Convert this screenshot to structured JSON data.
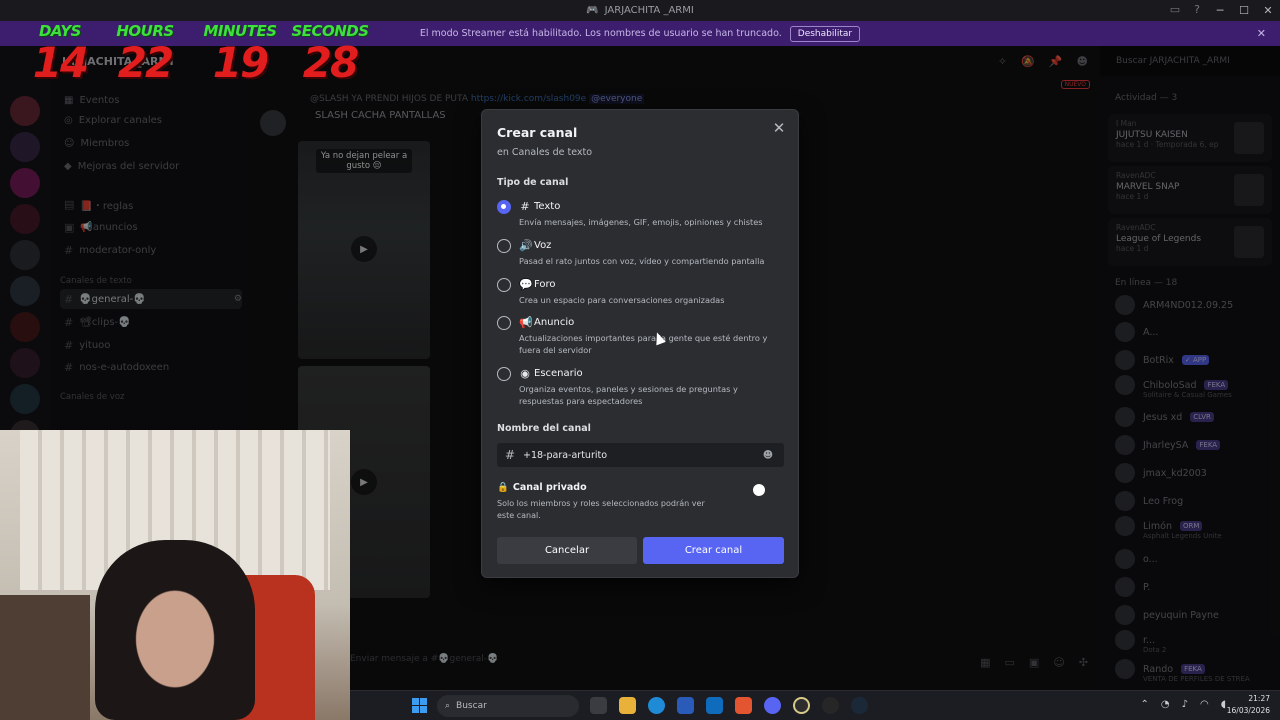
{
  "window": {
    "title": "JARJACHITA _ARMI"
  },
  "banner": {
    "text": "El modo Streamer está habilitado. Los nombres de usuario se han truncado.",
    "button": "Deshabilitar"
  },
  "countdown": [
    {
      "label": "DAYS",
      "value": "14"
    },
    {
      "label": "HOURS",
      "value": "22"
    },
    {
      "label": "MINUTES",
      "value": "19"
    },
    {
      "label": "SECONDS",
      "value": "28"
    }
  ],
  "sidebar": {
    "server_name": "JARJACHITA _ARMI",
    "top_items": [
      "Eventos",
      "Explorar canales",
      "Miembros",
      "Mejoras del servidor"
    ],
    "channels": [
      "📕・reglas",
      "📢anuncios",
      "moderator-only"
    ],
    "category_text": "Canales de texto",
    "text_channels": [
      "💀general-💀",
      "📽clips-💀",
      "yituoo",
      "nos-e-autodoxeen"
    ],
    "category_voice": "Canales de voz"
  },
  "main": {
    "message_reply": "@SLASH YA PRENDI HIJOS DE PUTA",
    "message_link": "https://kick.com/slash09e",
    "message_mention": "@everyone",
    "message_author": "SLASH CACHA PANTALLAS",
    "video_caption": "Ya no dejan pelear a gusto 😔",
    "composer_placeholder": "Enviar mensaje a #💀general-💀",
    "new_badge": "NUEVO"
  },
  "search": {
    "placeholder": "Buscar JARJACHITA _ARMI"
  },
  "members": {
    "activity_header": "Actividad — 3",
    "activities": [
      {
        "user": "I Man",
        "title": "JUJUTSU KAISEN",
        "meta": "hace 1 d · Temporada 6, ep"
      },
      {
        "user": "RavenADC",
        "title": "MARVEL SNAP",
        "meta": "hace 1 d"
      },
      {
        "user": "RavenADC",
        "title": "League of Legends",
        "meta": "hace 1 d"
      }
    ],
    "online_header": "En línea — 18",
    "list": [
      {
        "name": "ARM4ND012.09.25",
        "tag": "",
        "sub": ""
      },
      {
        "name": "A...",
        "tag": "",
        "sub": ""
      },
      {
        "name": "BotRix",
        "tag": "✓ APP",
        "sub": ""
      },
      {
        "name": "ChiboloSad",
        "tag": "FEKA",
        "sub": "Solitaire & Casual Games"
      },
      {
        "name": "Jesus xd",
        "tag": "CLVR",
        "sub": ""
      },
      {
        "name": "JharleySA",
        "tag": "FEKA",
        "sub": ""
      },
      {
        "name": "jmax_kd2003",
        "tag": "",
        "sub": ""
      },
      {
        "name": "Leo Frog",
        "tag": "",
        "sub": ""
      },
      {
        "name": "Limón",
        "tag": "ORM",
        "sub": "Asphalt Legends Unite"
      },
      {
        "name": "o...",
        "tag": "",
        "sub": ""
      },
      {
        "name": "P.",
        "tag": "",
        "sub": ""
      },
      {
        "name": "peyuquin Payne",
        "tag": "",
        "sub": ""
      },
      {
        "name": "r...",
        "tag": "",
        "sub": "Dota 2"
      },
      {
        "name": "Rando",
        "tag": "FEKA",
        "sub": "VENTA DE PERFILES DE STREA"
      }
    ]
  },
  "modal": {
    "title": "Crear canal",
    "subtitle": "en Canales de texto",
    "type_label": "Tipo de canal",
    "options": [
      {
        "label": "Texto",
        "icon": "hash-icon",
        "desc": "Envía mensajes, imágenes, GIF, emojis, opiniones y chistes",
        "selected": true
      },
      {
        "label": "Voz",
        "icon": "speaker-icon",
        "desc": "Pasad el rato juntos con voz, vídeo y compartiendo pantalla",
        "selected": false
      },
      {
        "label": "Foro",
        "icon": "forum-icon",
        "desc": "Crea un espacio para conversaciones organizadas",
        "selected": false
      },
      {
        "label": "Anuncio",
        "icon": "megaphone-icon",
        "desc": "Actualizaciones importantes para la gente que esté dentro y fuera del servidor",
        "selected": false
      },
      {
        "label": "Escenario",
        "icon": "stage-icon",
        "desc": "Organiza eventos, paneles y sesiones de preguntas y respuestas para espectadores",
        "selected": false
      }
    ],
    "name_label": "Nombre del canal",
    "name_value": "+18-para-arturito",
    "private_label": "Canal privado",
    "private_desc": "Solo los miembros y roles seleccionados podrán ver este canal.",
    "cancel": "Cancelar",
    "create": "Crear canal"
  },
  "taskbar": {
    "search": "Buscar",
    "time": "21:27",
    "date": "16/03/2026"
  }
}
